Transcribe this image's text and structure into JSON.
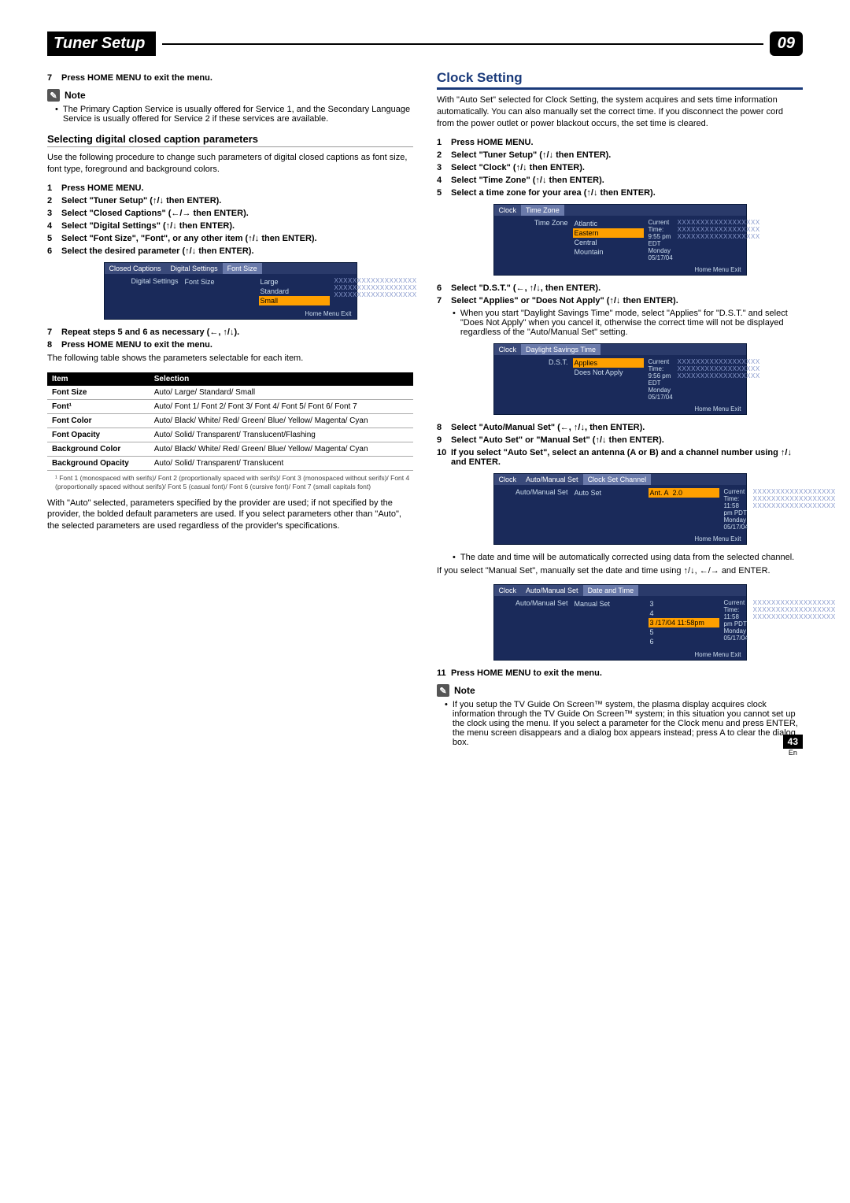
{
  "header": {
    "title": "Tuner Setup",
    "chapter": "09"
  },
  "left": {
    "step7": "Press HOME MENU to exit the menu.",
    "note_label": "Note",
    "note_text": "The Primary Caption Service is usually offered for Service 1, and the Secondary Language Service is usually offered for Service 2 if these services are available.",
    "subhead": "Selecting digital closed caption parameters",
    "intro": "Use the following procedure to change such parameters of digital closed captions as font size, font type, foreground and background colors.",
    "steps": [
      "Press HOME MENU.",
      "Select \"Tuner Setup\" (↑/↓ then ENTER).",
      "Select \"Closed Captions\" (←/→ then ENTER).",
      "Select \"Digital Settings\" (↑/↓ then ENTER).",
      "Select \"Font Size\", \"Font\", or any other item (↑/↓ then ENTER).",
      "Select the desired parameter (↑/↓ then ENTER)."
    ],
    "osd1": {
      "tabs": [
        "Closed Captions",
        "Digital Settings",
        "Font Size"
      ],
      "left_label": "Digital Settings",
      "mid_label": "Font Size",
      "options": [
        "Large",
        "Standard",
        "Small"
      ],
      "selected": "Small",
      "foot": "Home Menu    Exit"
    },
    "step7b": "Repeat steps 5 and 6 as necessary (←, ↑/↓).",
    "step8": "Press HOME MENU to exit the menu.",
    "table_intro": "The following table shows the parameters selectable for each item.",
    "table": {
      "headers": [
        "Item",
        "Selection"
      ],
      "rows": [
        [
          "Font Size",
          "Auto/ Large/ Standard/ Small"
        ],
        [
          "Font¹",
          "Auto/ Font 1/ Font 2/ Font 3/ Font 4/ Font 5/ Font 6/ Font 7"
        ],
        [
          "Font Color",
          "Auto/ Black/ White/ Red/ Green/ Blue/ Yellow/ Magenta/ Cyan"
        ],
        [
          "Font Opacity",
          "Auto/ Solid/ Transparent/ Translucent/Flashing"
        ],
        [
          "Background Color",
          "Auto/ Black/ White/ Red/ Green/ Blue/ Yellow/ Magenta/ Cyan"
        ],
        [
          "Background Opacity",
          "Auto/ Solid/ Transparent/ Translucent"
        ]
      ]
    },
    "footnote": "¹ Font 1 (monospaced with serifs)/ Font 2 (proportionally spaced with serifs)/ Font 3 (monospaced without serifs)/ Font 4 (proportionally spaced without serifs)/ Font 5 (casual font)/ Font 6 (cursive font)/ Font 7 (small capitals font)",
    "closing": "With \"Auto\" selected, parameters specified by the provider are used; if not specified by the provider, the bolded default parameters are used. If you select parameters other than \"Auto\", the selected parameters are used regardless of the provider's specifications."
  },
  "right": {
    "section": "Clock Setting",
    "intro": "With \"Auto Set\" selected for Clock Setting, the system acquires and sets time information automatically. You can also manually set the correct time. If you disconnect the power cord from the power outlet or power blackout occurs, the set time is cleared.",
    "steps": [
      "Press HOME MENU.",
      "Select \"Tuner Setup\" (↑/↓ then ENTER).",
      "Select \"Clock\" (↑/↓ then ENTER).",
      "Select \"Time Zone\" (↑/↓ then ENTER).",
      "Select a time zone for your area (↑/↓ then ENTER)."
    ],
    "osd_tz": {
      "tabs": [
        "Clock",
        "Time Zone"
      ],
      "left_label": "Time Zone",
      "options": [
        "Atlantic",
        "Eastern",
        "Central",
        "Mountain"
      ],
      "selected": "Eastern",
      "info": [
        "Current Time:",
        "9:55 pm EDT",
        "Monday",
        "05/17/04"
      ],
      "foot": "Home Menu    Exit"
    },
    "step6": "Select \"D.S.T.\" (←, ↑/↓, then ENTER).",
    "step7": "Select \"Applies\" or \"Does Not Apply\" (↑/↓ then ENTER).",
    "step7_bullet": "When you start \"Daylight Savings Time\" mode, select \"Applies\" for \"D.S.T.\" and select \"Does Not Apply\" when you cancel it, otherwise the correct time will not be displayed regardless of the \"Auto/Manual Set\" setting.",
    "osd_dst": {
      "tabs": [
        "Clock",
        "Daylight Savings Time"
      ],
      "left_label": "D.S.T.",
      "options": [
        "Applies",
        "Does Not Apply"
      ],
      "selected": "Applies",
      "info": [
        "Current Time:",
        "9:56 pm EDT",
        "Monday",
        "05/17/04"
      ],
      "foot": "Home Menu    Exit"
    },
    "step8": "Select \"Auto/Manual Set\" (←, ↑/↓, then ENTER).",
    "step9": "Select \"Auto Set\" or \"Manual Set\" (↑/↓ then ENTER).",
    "step10": "If you select \"Auto Set\", select an antenna (A or B) and a channel number using ↑/↓ and ENTER.",
    "osd_auto": {
      "tabs": [
        "Clock",
        "Auto/Manual Set",
        "Clock Set Channel"
      ],
      "left_label": "Auto/Manual Set",
      "mid_label": "Auto Set",
      "options": [
        "Ant. A",
        "2.0"
      ],
      "info": [
        "Current Time:",
        "11:58 pm PDT",
        "Monday",
        "05/17/04"
      ],
      "foot": "Home Menu    Exit"
    },
    "auto_bullet": "The date and time will be automatically corrected using data from the selected channel.",
    "manual_intro": "If you select \"Manual Set\", manually set the date and time using ↑/↓, ←/→ and ENTER.",
    "osd_manual": {
      "tabs": [
        "Clock",
        "Auto/Manual Set",
        "Date and Time"
      ],
      "left_label": "Auto/Manual Set",
      "mid_label": "Manual Set",
      "options": [
        "3",
        "4",
        "3 /17/04 11:58pm",
        "5",
        "6"
      ],
      "selected": "3 /17/04 11:58pm",
      "info": [
        "Current Time:",
        "11:58 pm PDT",
        "Monday",
        "05/17/04"
      ],
      "foot": "Home Menu    Exit"
    },
    "step11": "Press HOME MENU to exit the menu.",
    "note_label": "Note",
    "note_text": "If you setup the TV Guide On Screen™ system, the plasma display acquires clock information through the TV Guide On Screen™ system; in this situation you cannot set up the clock using the menu. If you select a parameter for the Clock menu and press ENTER, the menu screen disappears and a dialog box appears instead; press A to clear the dialog box."
  },
  "page": {
    "num": "43",
    "lang": "En"
  }
}
